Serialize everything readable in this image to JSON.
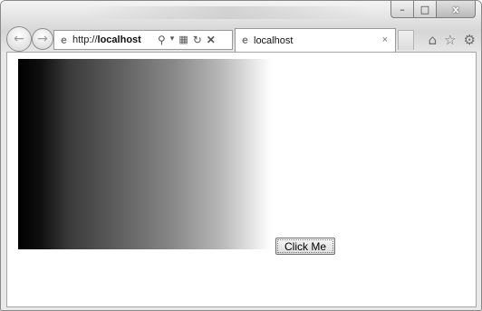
{
  "window": {
    "caption_buttons": {
      "minimize": "–",
      "maximize": "□",
      "close": "x"
    }
  },
  "toolbar": {
    "back_icon": "back-arrow-icon",
    "forward_icon": "forward-arrow-icon",
    "address": {
      "prefix": "http://",
      "host": "localhost"
    },
    "address_icons": [
      "search-icon",
      "dropdown-icon",
      "compat-icon",
      "refresh-icon",
      "stop-icon"
    ],
    "tab": {
      "title": "localhost",
      "close": "×"
    },
    "right_icons": [
      "home-icon",
      "favorites-star-icon",
      "tools-gear-icon"
    ]
  },
  "page": {
    "button_label": "Click Me"
  }
}
